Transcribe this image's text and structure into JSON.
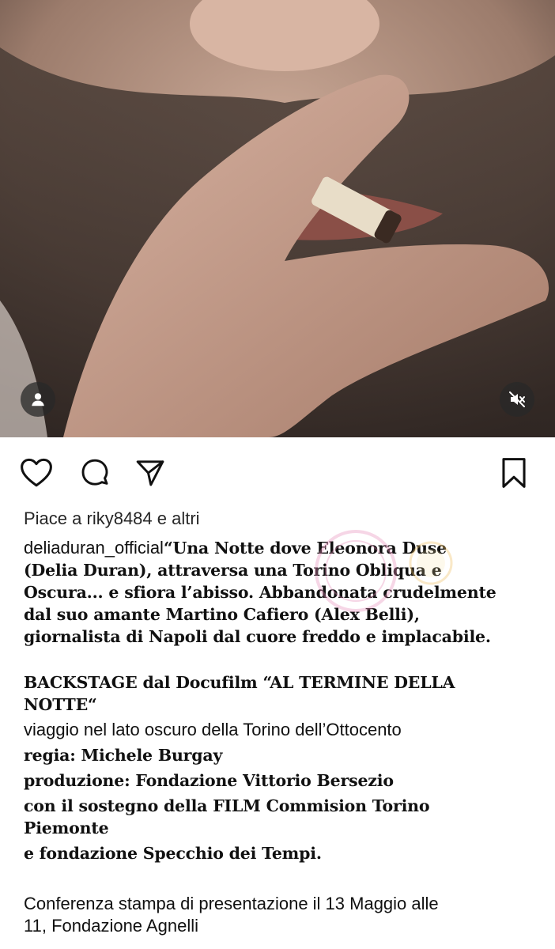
{
  "post": {
    "likes_text": "Piace a riky8484 e altri",
    "username": "deliaduran_official",
    "caption_lines": [
      "“Una Notte dove Eleonora Duse",
      "(Delia Duran), attraversa una Torino Obliqua e",
      "Oscura... e sfiora l’abisso. Abbandonata crudelmente",
      "dal suo amante Martino Cafiero (Alex Belli),",
      "giornalista di Napoli dal cuore freddo e implacabile."
    ],
    "backstage_lines": [
      "BACKSTAGE dal Docufilm “AL TERMINE DELLA",
      "NOTTE“"
    ],
    "subtitle": "viaggio nel lato oscuro della Torino dell’Ottocento",
    "credit_lines": [
      "regia: Michele Burgay",
      "produzione: Fondazione Vittorio Bersezio",
      "con il sostegno della FILM Commision Torino",
      "Piemonte",
      "e fondazione Specchio dei Tempi."
    ],
    "conference_lines": [
      "Conferenza stampa di presentazione il 13 Maggio alle",
      "11, Fondazione Agnelli"
    ]
  },
  "icons": {
    "like": "heart-icon",
    "comment": "comment-icon",
    "share": "send-icon",
    "save": "bookmark-icon",
    "user_tag": "user-icon",
    "mute": "volume-muted-icon"
  },
  "colors": {
    "text": "#111111",
    "overlay": "#333333"
  }
}
